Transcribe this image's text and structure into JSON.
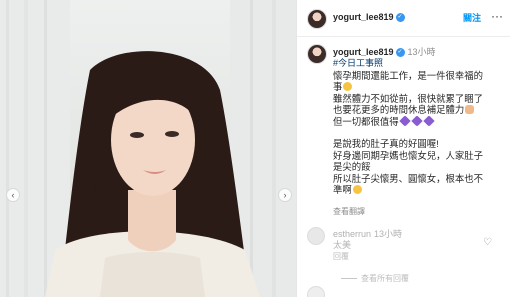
{
  "post": {
    "username": "yogurt_lee819",
    "follow_label": "關注",
    "more_label": "···"
  },
  "caption": {
    "username": "yogurt_lee819",
    "time": "13小時",
    "hashtag": "#今日工事照",
    "lines": [
      "懷孕期間還能工作，是一件很幸福的",
      "事",
      "雖然體力不如從前，很快就累了睏了",
      "也要花更多的時間休息補足體力",
      "但一切都很值得",
      "",
      "是說我的肚子真的好圓喔!",
      "好身邊同期孕媽也懷女兒，人家肚子",
      "是尖的餒",
      "所以肚子尖懷男、圓懷女，根本也不",
      "準啊"
    ],
    "translate_label": "查看翻譯"
  },
  "comment": {
    "username": "estherrun",
    "time": "13小時",
    "text": "太美",
    "reply_label": "回覆",
    "more_replies": "查看所有回覆"
  },
  "icons": {
    "verified": "verified-badge-icon",
    "prev": "chevron-left-icon",
    "next": "chevron-right-icon",
    "like": "heart-outline-icon"
  },
  "colors": {
    "accent": "#0095f6",
    "verified": "#3897f0",
    "hashtag": "#00376b"
  }
}
